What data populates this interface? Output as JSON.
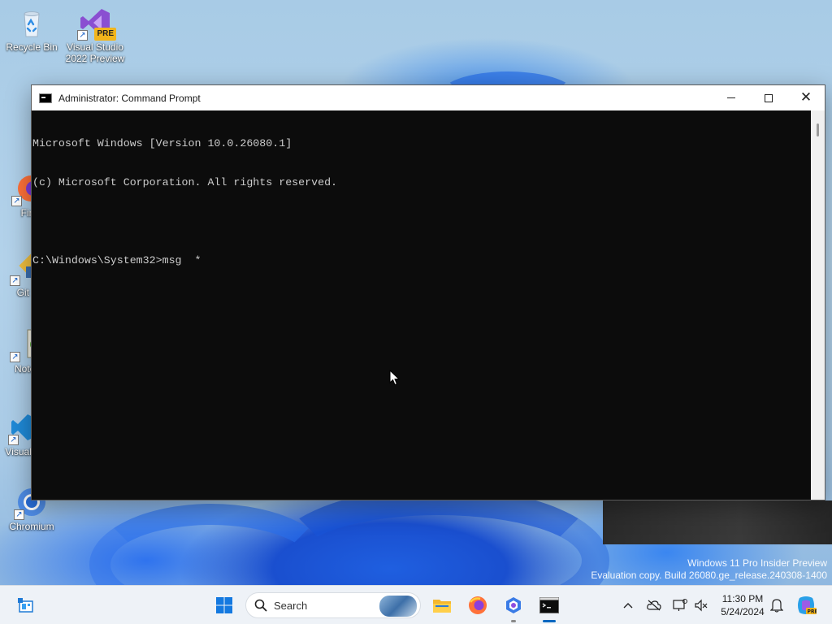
{
  "desktop": {
    "icons": [
      {
        "label": "Recycle Bin",
        "icon": "recycle-bin-icon"
      },
      {
        "label": "Visual Studio 2022 Preview",
        "icon": "visual-studio-icon",
        "badge": "PRE"
      },
      {
        "label": "Fire",
        "icon": "firefox-icon"
      },
      {
        "label": "Git B",
        "icon": "git-bash-icon"
      },
      {
        "label": "Notep",
        "icon": "notepad-plus-plus-icon"
      },
      {
        "label": "Visual Co",
        "icon": "vscode-icon"
      },
      {
        "label": "Chromium",
        "icon": "chromium-icon"
      }
    ],
    "watermark": {
      "line1": "Windows 11 Pro Insider Preview",
      "line2": "Evaluation copy. Build 26080.ge_release.240308-1400"
    }
  },
  "window": {
    "title": "Administrator: Command Prompt",
    "console_lines": [
      "Microsoft Windows [Version 10.0.26080.1]",
      "(c) Microsoft Corporation. All rights reserved.",
      "",
      "C:\\Windows\\System32>msg  *"
    ],
    "buttons": {
      "minimize": "minimize",
      "maximize": "maximize",
      "close": "close"
    }
  },
  "taskbar": {
    "search_label": "Search",
    "pinned": [
      {
        "name": "widgets",
        "icon": "widgets-icon"
      },
      {
        "name": "start",
        "icon": "windows-start-icon"
      },
      {
        "name": "file-explorer",
        "icon": "folder-icon"
      },
      {
        "name": "firefox",
        "icon": "firefox-icon"
      },
      {
        "name": "copilot",
        "icon": "copilot-icon"
      },
      {
        "name": "terminal",
        "icon": "command-prompt-icon",
        "active": true
      }
    ],
    "tray": {
      "time": "11:30 PM",
      "date": "5/24/2024"
    }
  },
  "colors": {
    "console_bg": "#0c0c0c",
    "console_fg": "#cccccc",
    "taskbar_bg": "#eef2f7",
    "accent": "#0067c0"
  }
}
